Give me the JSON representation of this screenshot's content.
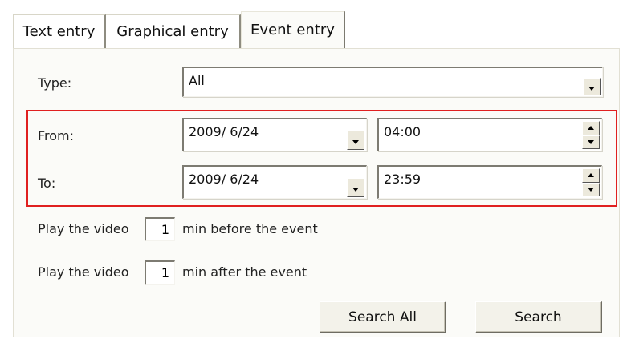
{
  "tabs": [
    {
      "label": "Text entry",
      "active": false
    },
    {
      "label": "Graphical entry",
      "active": false
    },
    {
      "label": "Event entry",
      "active": true
    }
  ],
  "type": {
    "label": "Type:",
    "value": "All"
  },
  "from": {
    "label": "From:",
    "date": "2009/ 6/24",
    "time": "04:00"
  },
  "to": {
    "label": "To:",
    "date": "2009/ 6/24",
    "time": "23:59"
  },
  "before": {
    "prefix": "Play the video",
    "value": "1",
    "suffix": "min before the event"
  },
  "after": {
    "prefix": "Play the video",
    "value": "1",
    "suffix": "min after the event"
  },
  "buttons": {
    "search_all": "Search All",
    "search": "Search"
  },
  "colors": {
    "highlight": "#e02020",
    "panel": "#fbfbf8",
    "button_face": "#ece9dc"
  },
  "icons": {
    "dropdown": "chevron-down-icon",
    "spin_up": "spin-up-icon",
    "spin_down": "spin-down-icon"
  }
}
